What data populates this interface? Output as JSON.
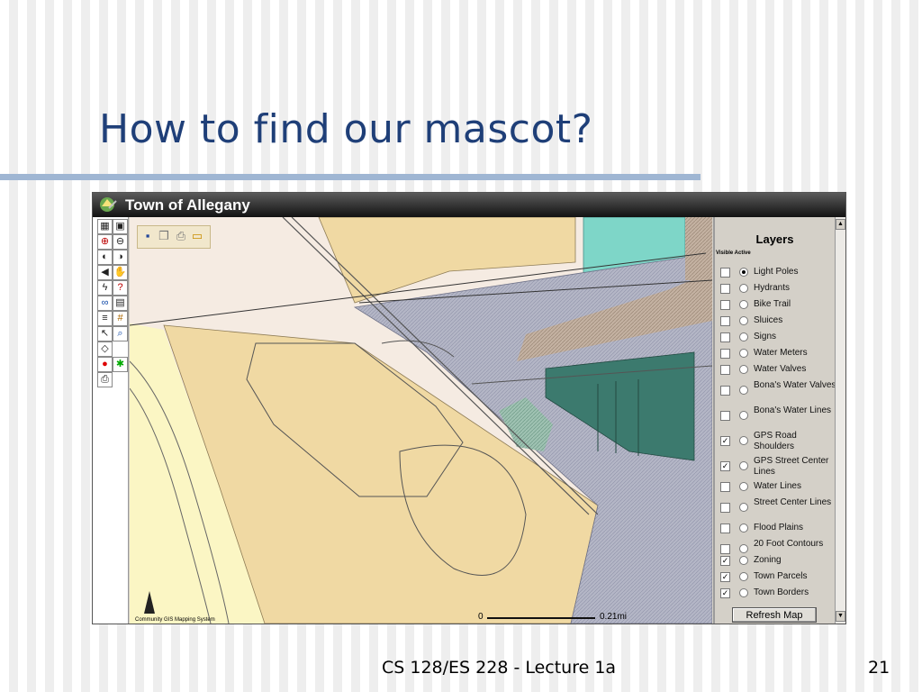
{
  "slide": {
    "title": "How to find our mascot?",
    "footer": "CS 128/ES 228 - Lecture 1a",
    "page_number": "21"
  },
  "app": {
    "title": "Town of Allegany",
    "toolbox_icons": [
      "legend-icon",
      "overview-icon",
      "zoom-in-icon",
      "zoom-out-icon",
      "zoom-previous-icon",
      "zoom-full-icon",
      "back-icon",
      "pan-hand-icon",
      "identify-icon",
      "query-icon",
      "find-icon",
      "table-icon",
      "list-icon",
      "grid-icon",
      "select-icon",
      "search-layer-icon",
      "eraser-icon",
      "blank-icon",
      "stop-icon",
      "run-icon",
      "print-icon"
    ],
    "map_toolbar_icons": [
      "save-icon",
      "copy-icon",
      "print-icon",
      "open-folder-icon"
    ],
    "map_footer": "Community GIS Mapping System",
    "scalebar": {
      "start": "0",
      "end": "0.21mi"
    },
    "north_arrow": "N"
  },
  "layers_panel": {
    "heading": "Layers",
    "column_header": "Visible Active",
    "refresh_label": "Refresh Map",
    "items": [
      {
        "label": "Light Poles",
        "visible": false,
        "active": true
      },
      {
        "label": "Hydrants",
        "visible": false,
        "active": false
      },
      {
        "label": "Bike Trail",
        "visible": false,
        "active": false
      },
      {
        "label": "Sluices",
        "visible": false,
        "active": false
      },
      {
        "label": "Signs",
        "visible": false,
        "active": false
      },
      {
        "label": "Water Meters",
        "visible": false,
        "active": false
      },
      {
        "label": "Water Valves",
        "visible": false,
        "active": false
      },
      {
        "label": "Bona's Water Valves",
        "visible": false,
        "active": false
      },
      {
        "label": "Bona's Water Lines",
        "visible": false,
        "active": false
      },
      {
        "label": "GPS Road Shoulders",
        "visible": true,
        "active": false
      },
      {
        "label": "GPS Street Center Lines",
        "visible": true,
        "active": false
      },
      {
        "label": "Water Lines",
        "visible": false,
        "active": false
      },
      {
        "label": "Street Center Lines",
        "visible": false,
        "active": false
      },
      {
        "label": "Flood Plains",
        "visible": false,
        "active": false
      },
      {
        "label": "20 Foot Contours",
        "visible": false,
        "active": false
      },
      {
        "label": "Zoning",
        "visible": true,
        "active": false
      },
      {
        "label": "Town Parcels",
        "visible": true,
        "active": false
      },
      {
        "label": "Town Borders",
        "visible": true,
        "active": false
      }
    ]
  },
  "colors": {
    "title": "#1f3f78",
    "rule": "#9fb6d3",
    "residential": "#f0d9a3",
    "commercial": "#a9acbf",
    "industrial": "#3c7a6e",
    "water": "#7ed6c8",
    "floodplain": "#fbf6c4",
    "mixed": "#b8a898"
  }
}
